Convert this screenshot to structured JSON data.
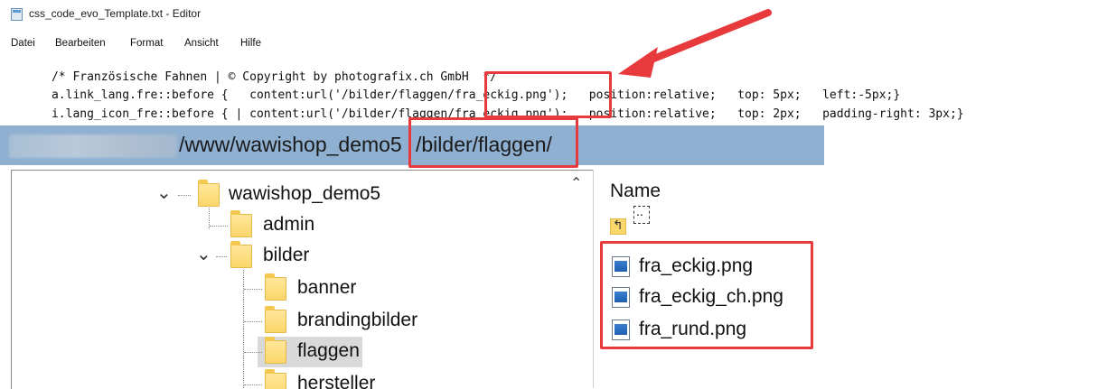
{
  "window": {
    "title": "css_code_evo_Template.txt - Editor",
    "icon": "notepad-icon"
  },
  "menu": [
    "Datei",
    "Bearbeiten",
    "Format",
    "Ansicht",
    "Hilfe"
  ],
  "code": {
    "comment": "/* Französische Fahnen | © Copyright by photografix.ch GmbH  */",
    "line1": {
      "selector": "a.link_lang.fre::before {   content:url('/bilder/flaggen/",
      "file": "fra_eckig.png",
      "rest": "');   position:relative;   top: 5px;   left:-5px;}"
    },
    "line2": {
      "selector": "i.lang_icon_fre::before { | content:url('/bilder/flaggen/",
      "file": "fra_eckig.png",
      "rest": "');   position:relative;   top: 2px;   padding-right: 3px;}"
    }
  },
  "explorer": {
    "path_prefix": "/www/wawishop_demo5",
    "path_highlight": "/bilder/flaggen/",
    "tree": {
      "root": "wawishop_demo5",
      "admin": "admin",
      "bilder": "bilder",
      "banner": "banner",
      "brandingbilder": "brandingbilder",
      "flaggen": "flaggen",
      "hersteller": "hersteller"
    },
    "files": {
      "header": "Name",
      "up": "..",
      "items": [
        "fra_eckig.png",
        "fra_eckig_ch.png",
        "fra_rund.png"
      ]
    }
  },
  "colors": {
    "highlight": "#e8393c",
    "path_bar": "#8fb0d1",
    "folder": "#fbd66a"
  }
}
